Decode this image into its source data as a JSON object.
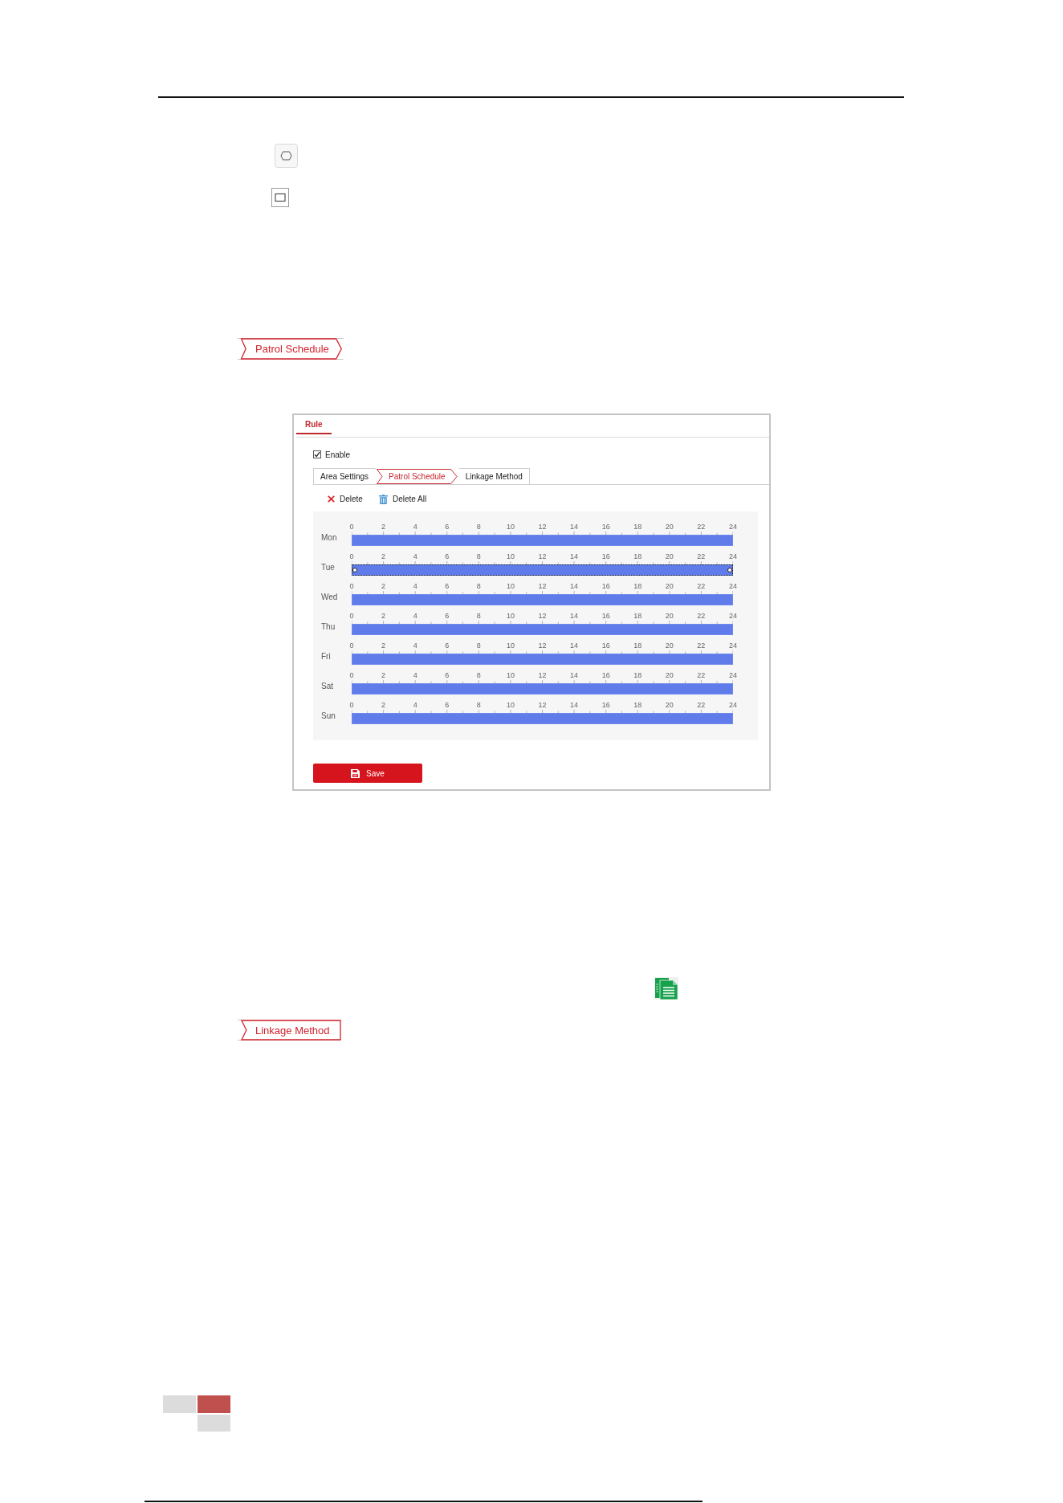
{
  "step_tag": {
    "label": "Patrol Schedule",
    "kind": "arrow"
  },
  "rule_panel": {
    "tabs": [
      {
        "label": "Rule",
        "selected": true
      }
    ],
    "enable": {
      "label": "Enable",
      "checked": true
    },
    "steps": [
      {
        "label": "Area Settings",
        "selected": false
      },
      {
        "label": "Patrol Schedule",
        "selected": true
      },
      {
        "label": "Linkage Method",
        "selected": false
      }
    ],
    "actions": [
      {
        "kind": "delete",
        "label": "Delete"
      },
      {
        "kind": "delete_all",
        "label": "Delete All"
      }
    ],
    "schedule": {
      "days": [
        {
          "label": "Mon",
          "selected": false,
          "level": 1,
          "hours": [
            "0",
            "2",
            "4",
            "6",
            "8",
            "10",
            "12",
            "14",
            "16",
            "18",
            "20",
            "22",
            "24"
          ]
        },
        {
          "label": "Tue",
          "selected": true,
          "level": 1,
          "hours": [
            "0",
            "2",
            "4",
            "6",
            "8",
            "10",
            "12",
            "14",
            "16",
            "18",
            "20",
            "22",
            "24"
          ]
        },
        {
          "label": "Wed",
          "selected": false,
          "level": 1,
          "hours": [
            "0",
            "2",
            "4",
            "6",
            "8",
            "10",
            "12",
            "14",
            "16",
            "18",
            "20",
            "22",
            "24"
          ]
        },
        {
          "label": "Thu",
          "selected": false,
          "level": 1,
          "hours": [
            "0",
            "2",
            "4",
            "6",
            "8",
            "10",
            "12",
            "14",
            "16",
            "18",
            "20",
            "22",
            "24"
          ]
        },
        {
          "label": "Fri",
          "selected": false,
          "level": 1,
          "hours": [
            "0",
            "2",
            "4",
            "6",
            "8",
            "10",
            "12",
            "14",
            "16",
            "18",
            "20",
            "22",
            "24"
          ]
        },
        {
          "label": "Sat",
          "selected": false,
          "level": 1,
          "hours": [
            "0",
            "2",
            "4",
            "6",
            "8",
            "10",
            "12",
            "14",
            "16",
            "18",
            "20",
            "22",
            "24"
          ]
        },
        {
          "label": "Sun",
          "selected": false,
          "level": 1,
          "hours": [
            "0",
            "2",
            "4",
            "6",
            "8",
            "10",
            "12",
            "14",
            "16",
            "18",
            "20",
            "22",
            "24"
          ]
        }
      ]
    },
    "save_button": {
      "label": "Save"
    }
  },
  "next_step_tag": {
    "label": "Linkage Method",
    "kind": "notched"
  }
}
